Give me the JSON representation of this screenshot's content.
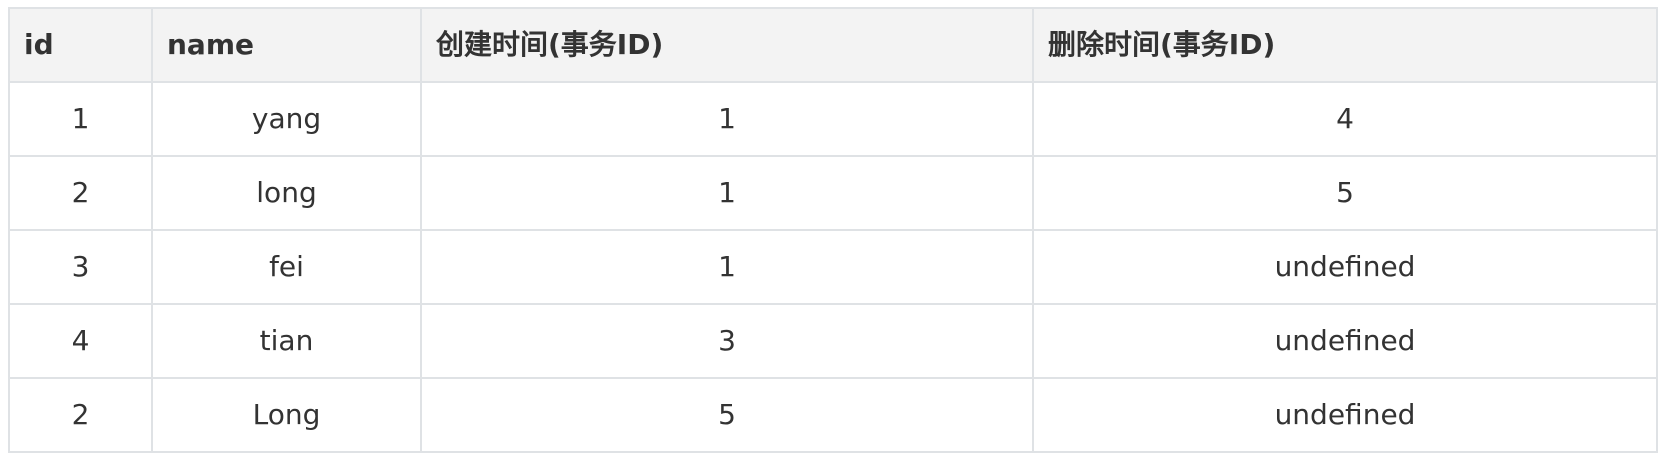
{
  "table": {
    "columns": [
      "id",
      "name",
      "创建时间(事务ID)",
      "删除时间(事务ID)"
    ],
    "rows": [
      {
        "id": "1",
        "name": "yang",
        "create": "1",
        "delete": "4"
      },
      {
        "id": "2",
        "name": "long",
        "create": "1",
        "delete": "5"
      },
      {
        "id": "3",
        "name": "fei",
        "create": "1",
        "delete": "undefined"
      },
      {
        "id": "4",
        "name": "tian",
        "create": "3",
        "delete": "undefined"
      },
      {
        "id": "2",
        "name": "Long",
        "create": "5",
        "delete": "undefined"
      }
    ]
  },
  "colors": {
    "header_bg": "#f3f3f3",
    "border": "#dfe2e5",
    "text": "#333333"
  }
}
